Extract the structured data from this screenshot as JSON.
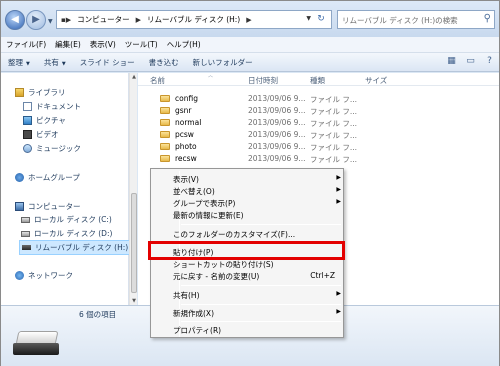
{
  "address": {
    "crumbs": [
      "コンピューター",
      "リムーバブル ディスク (H:)"
    ],
    "search_placeholder": "リムーバブル ディスク (H:)の検索"
  },
  "menubar": [
    "ファイル(F)",
    "編集(E)",
    "表示(V)",
    "ツール(T)",
    "ヘルプ(H)"
  ],
  "toolbar": {
    "organize": "整理",
    "share": "共有",
    "slideshow": "スライド ショー",
    "burn": "書き込む",
    "new_folder": "新しいフォルダー"
  },
  "nav": {
    "libraries": "ライブラリ",
    "documents": "ドキュメント",
    "pictures": "ピクチャ",
    "videos": "ビデオ",
    "music": "ミュージック",
    "homegroup": "ホームグループ",
    "computer": "コンピューター",
    "local_c": "ローカル ディスク (C:)",
    "local_d": "ローカル ディスク (D:)",
    "removable_h": "リムーバブル ディスク (H:)",
    "network": "ネットワーク"
  },
  "columns": {
    "name": "名前",
    "date": "日付時刻",
    "type": "種類",
    "size": "サイズ"
  },
  "files": [
    {
      "name": "config",
      "date": "2013/09/06 9...",
      "type": "ファイル フ..."
    },
    {
      "name": "gsnr",
      "date": "2013/09/06 9...",
      "type": "ファイル フ..."
    },
    {
      "name": "normal",
      "date": "2013/09/06 9...",
      "type": "ファイル フ..."
    },
    {
      "name": "pcsw",
      "date": "2013/09/06 9...",
      "type": "ファイル フ..."
    },
    {
      "name": "photo",
      "date": "2013/09/06 9...",
      "type": "ファイル フ..."
    },
    {
      "name": "recsw",
      "date": "2013/09/06 9...",
      "type": "ファイル フ..."
    }
  ],
  "details": {
    "item_count": "6 個の項目"
  },
  "context_menu": {
    "view": "表示(V)",
    "sort_by": "並べ替え(O)",
    "group_by": "グループで表示(P)",
    "refresh": "最新の情報に更新(E)",
    "customize": "このフォルダーのカスタマイズ(F)...",
    "paste": "貼り付け(P)",
    "paste_shortcut": "ショートカットの貼り付け(S)",
    "undo": "元に戻す - 名前の変更(U)",
    "undo_shortcut": "Ctrl+Z",
    "share": "共有(H)",
    "new": "新規作成(X)",
    "properties": "プロパティ(R)"
  },
  "colors": {
    "highlight_border": "#e30000",
    "selected_nav": "#cde8ff"
  }
}
